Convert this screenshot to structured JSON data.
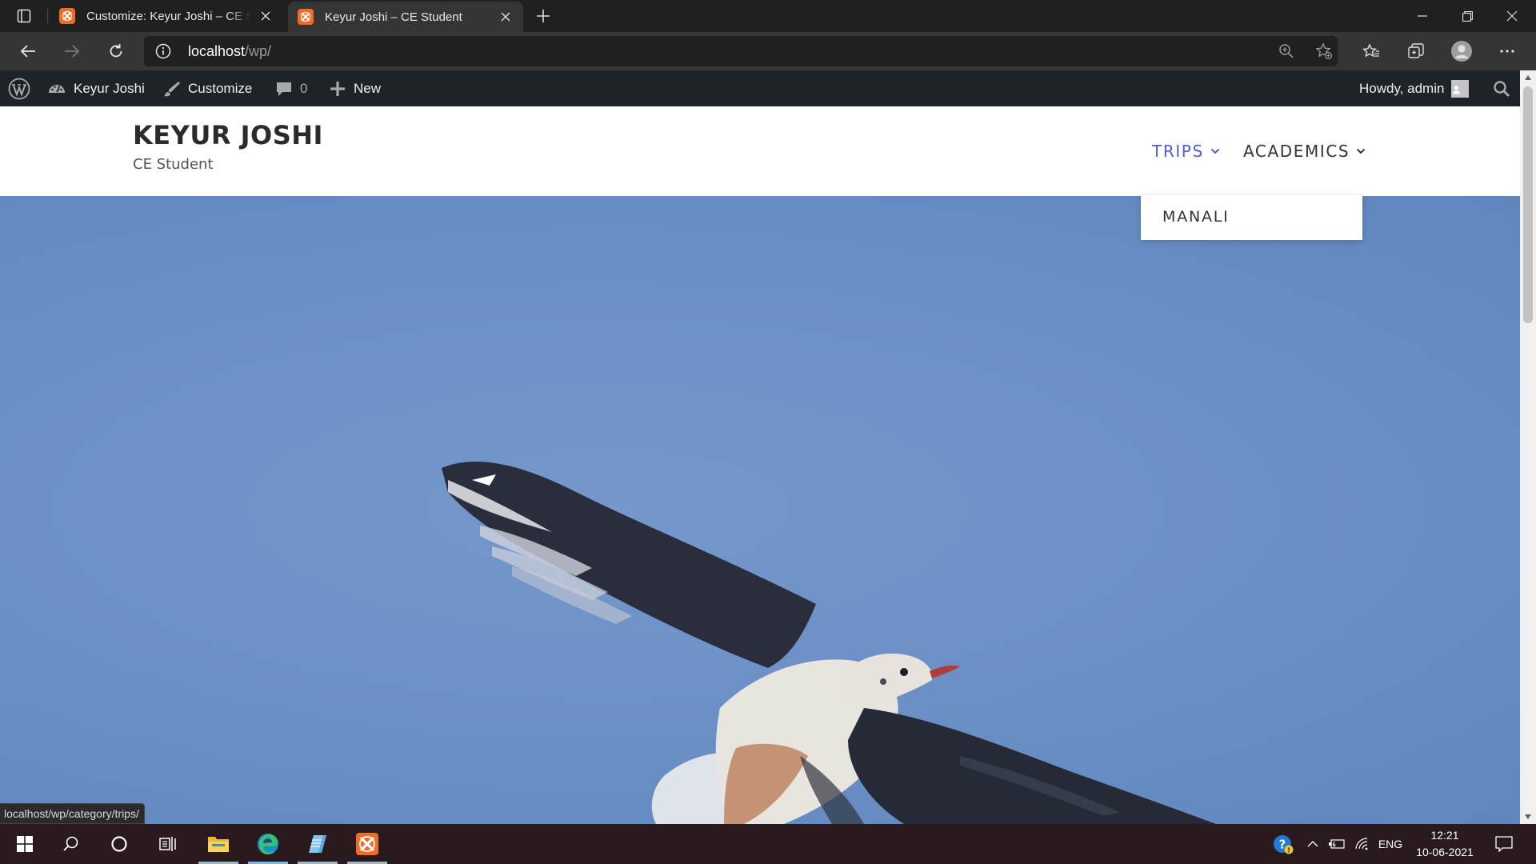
{
  "browser": {
    "tabs": [
      {
        "title": "Customize: Keyur Joshi – CE Student",
        "active": false
      },
      {
        "title": "Keyur Joshi – CE Student",
        "active": true
      }
    ],
    "address": {
      "host": "localhost",
      "path": "/wp/"
    }
  },
  "admin_bar": {
    "site_name": "Keyur Joshi",
    "customize": "Customize",
    "comments_count": "0",
    "new": "New",
    "howdy": "Howdy, admin"
  },
  "site": {
    "title": "KEYUR JOSHI",
    "tagline": "CE Student",
    "menu": [
      {
        "label": "TRIPS",
        "active": true,
        "submenu": [
          "MANALI"
        ]
      },
      {
        "label": "ACADEMICS",
        "active": false
      }
    ],
    "hero_image": "seagull-flying-in-blue-sky"
  },
  "status_bar_url": "localhost/wp/category/trips/",
  "taskbar": {
    "apps": [
      "start-icon",
      "search-icon",
      "cortana-icon",
      "task-view-icon",
      "file-explorer-icon",
      "edge-icon",
      "notepad-icon",
      "xampp-icon"
    ],
    "tray": {
      "language": "ENG",
      "time": "12:21",
      "date": "10-06-2021"
    }
  },
  "colors": {
    "wp_admin_bar": "#1d2327",
    "menu_active": "#4a5fd6",
    "sky": "#6a8fc5",
    "xampp": "#f06d25"
  }
}
